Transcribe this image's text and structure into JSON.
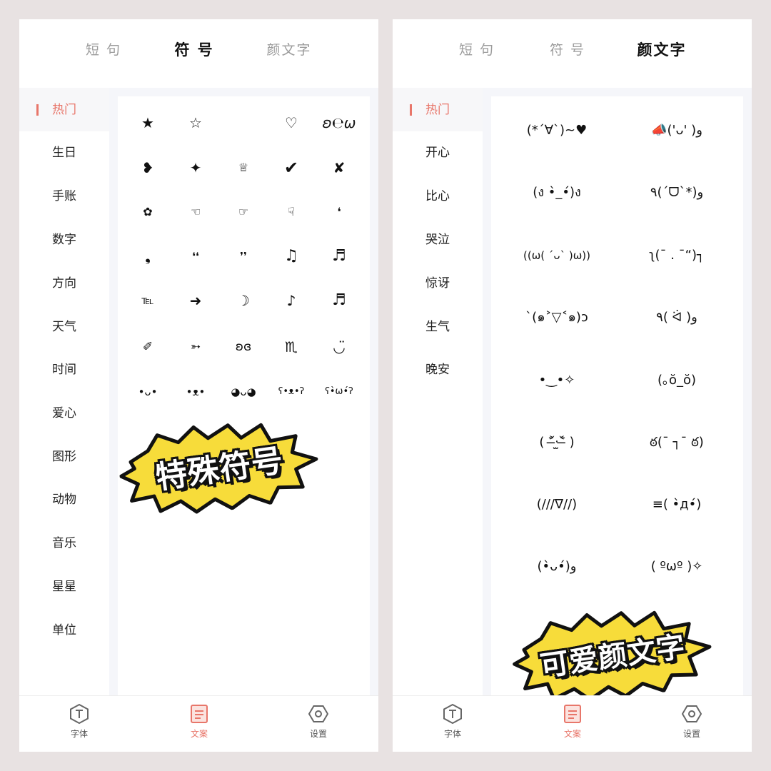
{
  "left": {
    "tabs": [
      {
        "label": "短 句",
        "active": false
      },
      {
        "label": "符 号",
        "active": true
      },
      {
        "label": "颜文字",
        "active": false
      }
    ],
    "sidebar": [
      "热门",
      "生日",
      "手账",
      "数字",
      "方向",
      "天气",
      "时间",
      "爱心",
      "图形",
      "动物",
      "音乐",
      "星星",
      "单位"
    ],
    "symbols": [
      [
        "★",
        "☆",
        "",
        "♡",
        "ʚ℮ω"
      ],
      [
        "❥",
        "✦",
        "♕",
        "✔",
        "✘"
      ],
      [
        "✿",
        "☜",
        "☞",
        "☟",
        "❛"
      ],
      [
        "❟",
        "❛❛",
        "❜❜",
        "♫",
        "♬"
      ],
      [
        "℡",
        "➜",
        "☽",
        "♪",
        "♬"
      ],
      [
        "✐",
        "➳",
        "ʚɞ",
        "♏",
        "◡̈"
      ],
      [
        "•ᴗ•",
        "•ᴥ•",
        "◕ᴗ◕",
        "ʕ•ᴥ•ʔ",
        "ʕ•̀ω•́ʔ"
      ]
    ],
    "sticker": "特殊符号"
  },
  "right": {
    "tabs": [
      {
        "label": "短 句",
        "active": false
      },
      {
        "label": "符 号",
        "active": false
      },
      {
        "label": "颜文字",
        "active": true
      }
    ],
    "sidebar": [
      "热门",
      "开心",
      "比心",
      "哭泣",
      "惊讶",
      "生气",
      "晚安"
    ],
    "kaomoji": [
      [
        "(*´∀`)~♥",
        "📣('ᴗ' )و"
      ],
      [
        "(ง •̀_•́)ง",
        "٩(ˊᗜˋ*)و"
      ],
      [
        "((ω( ´ᴗ` )ω))",
        "ʅ(¯ . ¯“)┐"
      ],
      [
        "ˋ(๑˃▽˂๑)ɔ",
        "٩( ᐛ )و"
      ],
      [
        "•‿•✧",
        "(｡ŏ_ŏ)"
      ],
      [
        "( ˃̶᷄‧̫˂̶᷅ )",
        "ఠ(¯ ┐¯ ఠ)"
      ],
      [
        "(///∇//)",
        "≡( •̀д•́)"
      ],
      [
        "(•̀ᴗ•́)و",
        "( ºωº )✧"
      ]
    ],
    "sticker": "可爱颜文字"
  },
  "bottom_nav": [
    {
      "label": "字体",
      "icon": "font-t-icon",
      "active": false
    },
    {
      "label": "文案",
      "icon": "document-icon",
      "active": true
    },
    {
      "label": "设置",
      "icon": "settings-hex-icon",
      "active": false
    }
  ],
  "colors": {
    "accent": "#e8766a",
    "sticker_yellow": "#f7dc3a",
    "tab_highlight": "#f4c8c0"
  }
}
